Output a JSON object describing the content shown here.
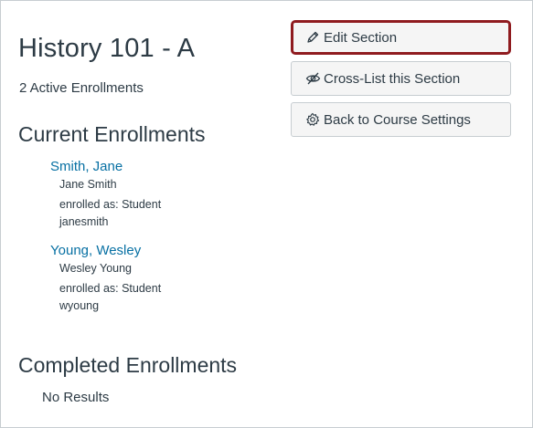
{
  "section": {
    "title": "History 101 - A",
    "active_enrollments": "2 Active Enrollments"
  },
  "current_enrollments": {
    "heading": "Current Enrollments",
    "students": [
      {
        "link_name": "Smith, Jane",
        "full_name": "Jane Smith",
        "role": "enrolled as: Student",
        "login": "janesmith"
      },
      {
        "link_name": "Young, Wesley",
        "full_name": "Wesley Young",
        "role": "enrolled as: Student",
        "login": "wyoung"
      }
    ]
  },
  "completed_enrollments": {
    "heading": "Completed Enrollments",
    "empty_text": "No Results"
  },
  "actions": {
    "edit_label": "Edit Section",
    "edit_icon": "pencil-icon",
    "crosslist_label": "Cross-List this Section",
    "crosslist_icon": "eye-slash-icon",
    "back_label": "Back to Course Settings",
    "back_icon": "gear-icon"
  },
  "colors": {
    "link": "#0770a3",
    "highlight_border": "#8f1b1f",
    "text": "#2d3b45",
    "button_bg": "#f5f5f5"
  }
}
